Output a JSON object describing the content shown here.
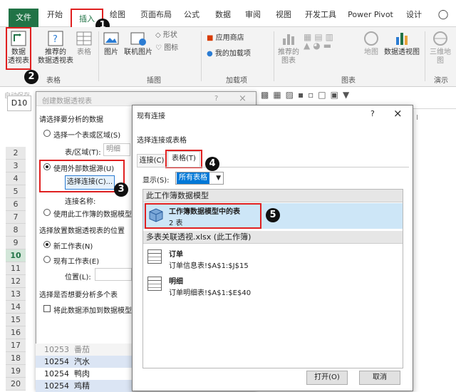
{
  "ribbon_tabs": [
    "文件",
    "开始",
    "插入",
    "绘图",
    "页面布局",
    "公式",
    "数据",
    "审阅",
    "视图",
    "开发工具",
    "Power Pivot",
    "设计"
  ],
  "ribbon": {
    "pivot_table": "数据\n透视表",
    "recommended_pivot": "推荐的\n数据透视表",
    "table": "表格",
    "picture": "图片",
    "online_picture": "联机图片",
    "shapes": "形状",
    "icons": "图标",
    "app_store": "应用商店",
    "my_addins": "我的加载项",
    "recommended_charts": "推荐的\n图表",
    "map": "地图",
    "pivot_chart": "数据透视图",
    "3d_map": "三维地\n图",
    "group_tables": "表格",
    "group_illustrations": "插图",
    "group_addins": "加载项",
    "group_charts": "图表",
    "group_tours": "演示"
  },
  "sheet": {
    "name_box": "D10",
    "autosave": "自动保存",
    "row_numbers": [
      "2",
      "3",
      "4",
      "5",
      "6",
      "7",
      "8",
      "9",
      "10",
      "11",
      "12",
      "13",
      "14",
      "15",
      "16",
      "17",
      "18",
      "19",
      "20"
    ],
    "selected_row": "10",
    "rows": [
      {
        "num": "10253",
        "text": "番茄"
      },
      {
        "num": "10254",
        "text": "汽水"
      },
      {
        "num": "10254",
        "text": "鸭肉"
      },
      {
        "num": "10254",
        "text": "鸡精"
      }
    ]
  },
  "create_pivot_dialog": {
    "title": "创建数据透视表",
    "section_select_data": "请选择要分析的数据",
    "opt_select_range": "选择一个表或区域(S)",
    "label_range": "表/区域(T):",
    "range_value": "明细",
    "opt_external": "使用外部数据源(U)",
    "btn_choose_connection": "选择连接(C)...",
    "label_connection_name": "连接名称:",
    "opt_data_model": "使用此工作簿的数据模型(",
    "section_location": "选择放置数据透视表的位置",
    "opt_new_sheet": "新工作表(N)",
    "opt_existing_sheet": "现有工作表(E)",
    "label_location": "位置(L):",
    "section_multi": "选择是否想要分析多个表",
    "chk_add_to_model": "将此数据添加到数据模型("
  },
  "existing_connections": {
    "title": "现有连接",
    "help": "?",
    "close": "×",
    "subtitle": "选择连接或表格",
    "tab_connections": "连接(C)",
    "tab_tables": "表格(T)",
    "show_label": "显示(S):",
    "show_value": "所有表格",
    "section_model": "此工作簿数据模型",
    "model_item_title": "工作簿数据模型中的表",
    "model_item_sub": "2 表",
    "section_workbook": "多表关联透视.xlsx (此工作簿)",
    "tables": [
      {
        "name": "订单",
        "ref": "订单信息表!$A$1:$J$15"
      },
      {
        "name": "明细",
        "ref": "订单明细表!$A$1:$E$40"
      }
    ],
    "btn_open": "打开(O)",
    "btn_cancel": "取消"
  },
  "badges": [
    "1",
    "2",
    "3",
    "4",
    "5"
  ],
  "colors": {
    "excel_green": "#217346",
    "highlight_red": "#e02020",
    "selection_blue": "#cde6f7"
  }
}
